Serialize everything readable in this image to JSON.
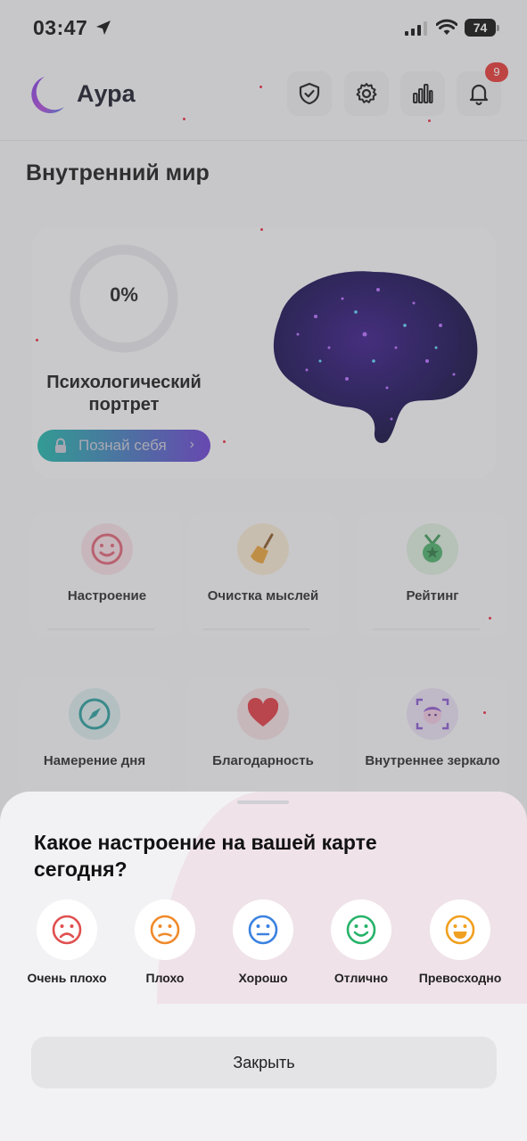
{
  "status_bar": {
    "time": "03:47",
    "battery": "74"
  },
  "header": {
    "app_title": "Аура",
    "notifications_count": "9"
  },
  "section_title": "Внутренний мир",
  "portrait": {
    "progress_label": "0%",
    "progress": 0,
    "title": "Психологический портрет",
    "cta": "Познай себя"
  },
  "tiles": [
    {
      "label": "Настроение",
      "icon": "smile-icon"
    },
    {
      "label": "Очистка мыслей",
      "icon": "broom-icon"
    },
    {
      "label": "Рейтинг",
      "icon": "medal-icon"
    },
    {
      "label": "Намерение дня",
      "icon": "compass-icon"
    },
    {
      "label": "Благодарность",
      "icon": "heart-icon"
    },
    {
      "label": "Внутреннее зеркало",
      "icon": "face-scan-icon"
    }
  ],
  "sheet": {
    "title": "Какое настроение на вашей карте сегодня?",
    "options": [
      {
        "label": "Очень плохо",
        "icon": "very-bad-face-icon",
        "color": "#e05050"
      },
      {
        "label": "Плохо",
        "icon": "bad-face-icon",
        "color": "#f08a2c"
      },
      {
        "label": "Хорошо",
        "icon": "good-face-icon",
        "color": "#3b82e0"
      },
      {
        "label": "Отлично",
        "icon": "excellent-face-icon",
        "color": "#28b36a"
      },
      {
        "label": "Превосходно",
        "icon": "superb-face-icon",
        "color": "#f0a020"
      }
    ],
    "close_label": "Закрыть"
  },
  "colors": {
    "accent_teal": "#1fb5a8",
    "accent_purple": "#6a3fd1",
    "badge": "#e53935"
  }
}
